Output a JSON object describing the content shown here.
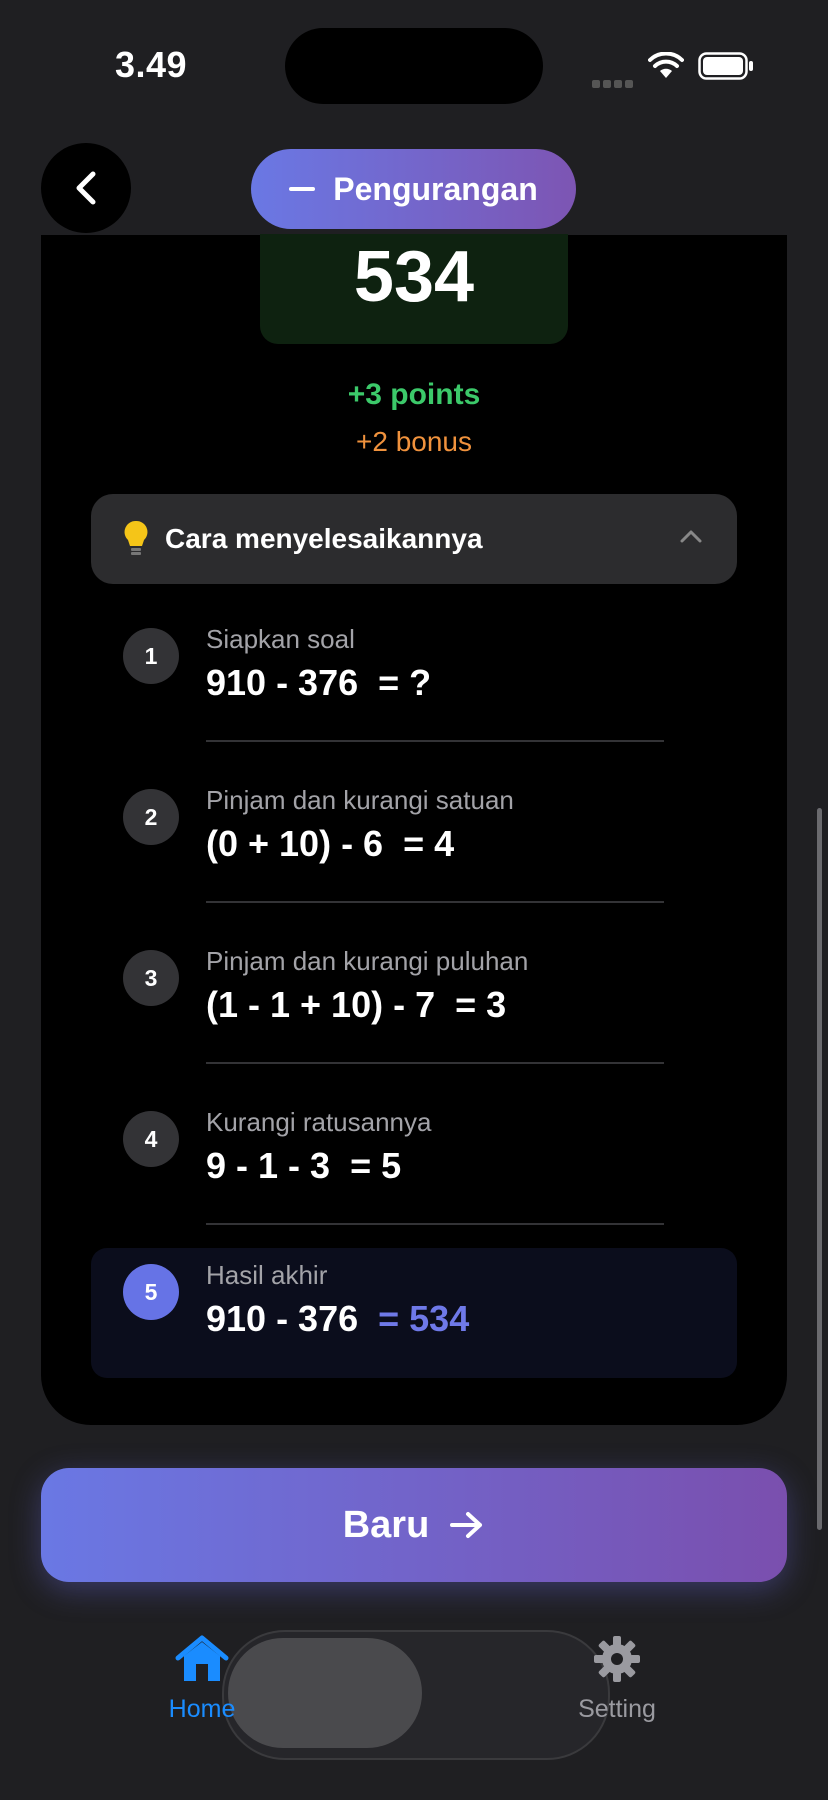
{
  "status_bar": {
    "time": "3.49"
  },
  "header": {
    "title": "Pengurangan"
  },
  "answer": {
    "value": "534",
    "points": "+3 points",
    "bonus": "+2 bonus"
  },
  "howto": {
    "label": "Cara menyelesaikannya"
  },
  "steps": [
    {
      "num": "1",
      "label": "Siapkan soal",
      "expr": "910 - 376 ",
      "result": " = ?"
    },
    {
      "num": "2",
      "label": "Pinjam dan kurangi satuan",
      "expr": "(0 + 10) - 6 ",
      "result": " = 4"
    },
    {
      "num": "3",
      "label": "Pinjam dan kurangi puluhan",
      "expr": "(1 - 1 + 10) - 7 ",
      "result": " = 3"
    },
    {
      "num": "4",
      "label": "Kurangi ratusannya",
      "expr": "9 - 1 - 3 ",
      "result": " = 5"
    },
    {
      "num": "5",
      "label": "Hasil akhir",
      "expr": "910 - 376 ",
      "result": " = 534"
    }
  ],
  "new_button": {
    "label": "Baru"
  },
  "tabs": [
    {
      "label": "Home",
      "icon": "house-icon",
      "active": true
    },
    {
      "label": "Setting",
      "icon": "gear-icon",
      "active": false
    }
  ],
  "colors": {
    "accent": "#6a78e4",
    "points": "#3cc96a",
    "bonus": "#f0923d",
    "tab_active": "#1a8cff"
  }
}
